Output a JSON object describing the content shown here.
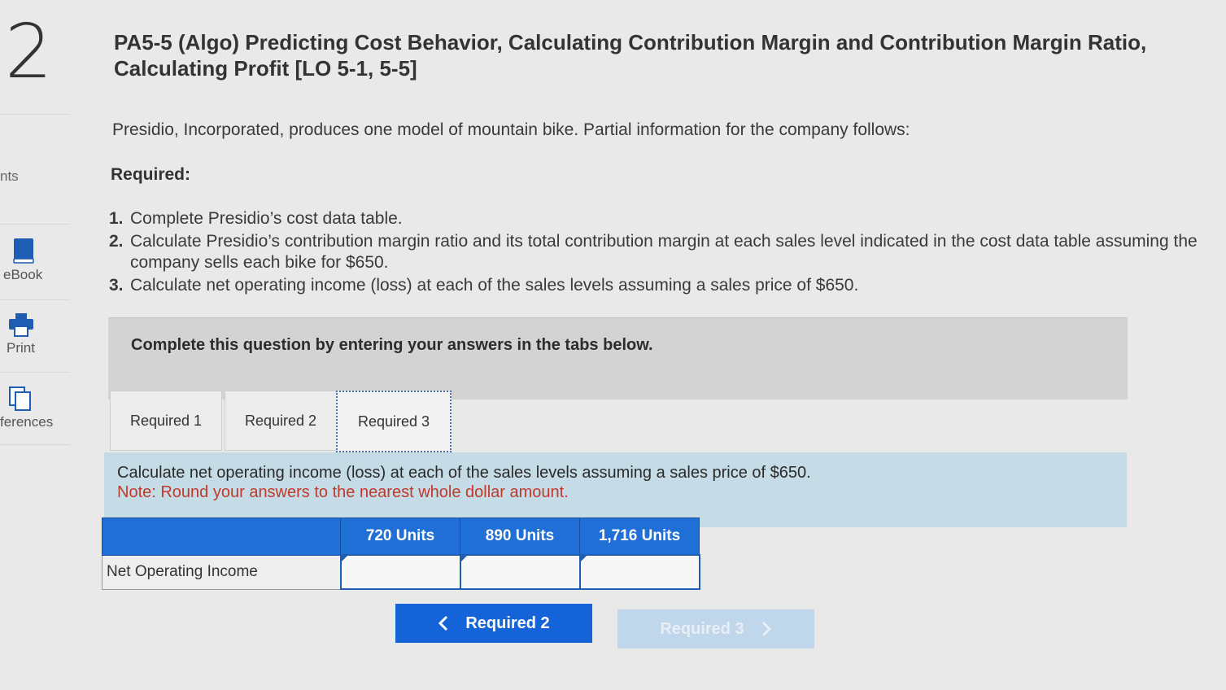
{
  "question_number": "2",
  "rail": {
    "points_label": "nts",
    "ebook_label": "eBook",
    "print_label": "Print",
    "references_label": "ferences"
  },
  "title": "PA5-5 (Algo) Predicting Cost Behavior, Calculating Contribution Margin and Contribution Margin Ratio, Calculating Profit [LO 5-1, 5-5]",
  "intro": "Presidio, Incorporated, produces one model of mountain bike. Partial information for the company follows:",
  "required_heading": "Required:",
  "requirements": [
    {
      "num": "1.",
      "text": "Complete Presidio’s cost data table."
    },
    {
      "num": "2.",
      "text": "Calculate Presidio’s contribution margin ratio and its total contribution margin at each sales level indicated in the cost data table assuming the company sells each bike for $650."
    },
    {
      "num": "3.",
      "text": "Calculate net operating income (loss) at each of the sales levels assuming a sales price of $650."
    }
  ],
  "instruction": "Complete this question by entering your answers in the tabs below.",
  "tabs": [
    {
      "label": "Required 1"
    },
    {
      "label": "Required 2"
    },
    {
      "label": "Required 3"
    }
  ],
  "content": {
    "line1": "Calculate net operating income (loss) at each of the sales levels assuming a sales price of $650.",
    "note": "Note: Round your answers to the nearest whole dollar amount."
  },
  "table": {
    "columns": [
      "",
      "720 Units",
      "890 Units",
      "1,716 Units"
    ],
    "rows": [
      {
        "label": "Net Operating Income",
        "values": [
          "",
          "",
          ""
        ]
      }
    ]
  },
  "nav": {
    "prev_label": "Required 2",
    "next_label": "Required 3"
  },
  "colors": {
    "accent": "#1463d8",
    "header": "#1f6fd6",
    "note": "#c0392b",
    "content_bg": "#c5dce6"
  }
}
